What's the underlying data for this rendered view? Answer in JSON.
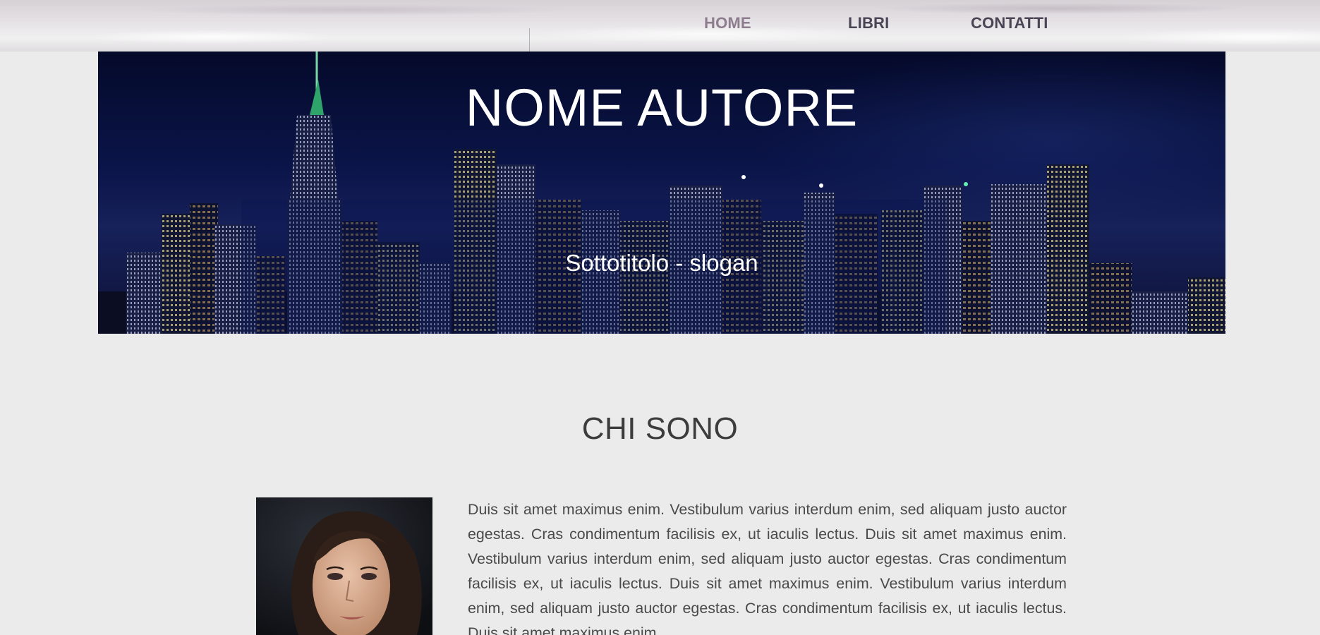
{
  "nav": {
    "items": [
      {
        "label": "HOME",
        "active": true
      },
      {
        "label": "LIBRI",
        "active": false
      },
      {
        "label": "CONTATTI",
        "active": false
      }
    ]
  },
  "hero": {
    "title": "NOME AUTORE",
    "subtitle": "Sottotitolo - slogan"
  },
  "about": {
    "title": "CHI SONO",
    "text": "Duis sit amet maximus enim. Vestibulum varius interdum enim, sed aliquam justo auctor egestas. Cras condimentum facilisis ex, ut iaculis lectus. Duis sit amet maximus enim. Vestibulum varius interdum enim, sed aliquam justo auctor egestas. Cras condimentum facilisis ex, ut iaculis lectus. Duis sit amet maximus enim. Vestibulum varius interdum enim, sed aliquam justo auctor egestas. Cras condimentum facilisis ex, ut iaculis lectus. Duis sit amet maximus enim."
  },
  "colors": {
    "page_background": "#ebebeb",
    "nav_text": "#4a4555",
    "nav_active": "#8e7d8e",
    "hero_sky": "#0a1448",
    "heading_text": "#3c3c3c",
    "body_text": "#4a4a4a"
  }
}
